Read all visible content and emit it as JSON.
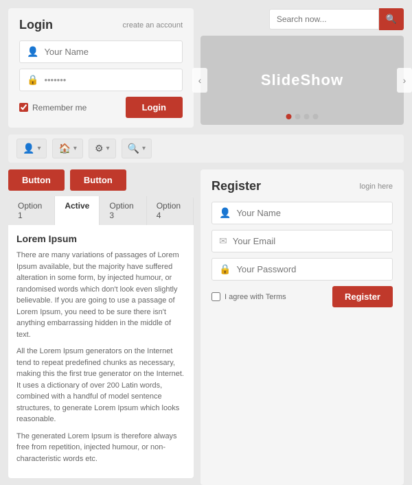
{
  "login": {
    "title": "Login",
    "create_account": "create an account",
    "name_placeholder": "Your Name",
    "password_value": "•••••••",
    "remember_label": "Remember me",
    "btn_label": "Login"
  },
  "search": {
    "placeholder": "Search now..."
  },
  "slideshow": {
    "label": "SlideShow",
    "prev": "‹",
    "next": "›",
    "dots": [
      true,
      false,
      false,
      false
    ]
  },
  "navbar": {
    "items": [
      {
        "icon": "👤",
        "arrow": "▾"
      },
      {
        "icon": "🏠",
        "arrow": "▾"
      },
      {
        "icon": "⚙",
        "arrow": "▾"
      },
      {
        "icon": "🔍",
        "arrow": "▾"
      }
    ]
  },
  "buttons": [
    {
      "label": "Button"
    },
    {
      "label": "Button"
    }
  ],
  "tabs": {
    "items": [
      {
        "label": "Option 1"
      },
      {
        "label": "Active"
      },
      {
        "label": "Option 3"
      },
      {
        "label": "Option 4"
      }
    ],
    "active_index": 1,
    "content_title": "Lorem Ipsum",
    "content_paragraphs": [
      "There are many variations of passages of Lorem Ipsum available, but the majority have suffered alteration in some form, by injected humour, or randomised words which don't look even slightly believable. If you are going to use a passage of Lorem Ipsum, you need to be sure there isn't anything embarrassing hidden in the middle of text.",
      "All the Lorem Ipsum generators on the Internet tend to repeat predefined chunks as necessary, making this the first true generator on the Internet. It uses a dictionary of over 200 Latin words, combined with a handful of model sentence structures, to generate Lorem Ipsum which looks reasonable.",
      "The generated Lorem Ipsum is therefore always free from repetition, injected humour, or non-characteristic words etc."
    ]
  },
  "register": {
    "title": "Register",
    "login_here": "login here",
    "name_placeholder": "Your Name",
    "email_placeholder": "Your Email",
    "password_placeholder": "Your Password",
    "agree_label": "I agree with Terms",
    "btn_label": "Register"
  }
}
